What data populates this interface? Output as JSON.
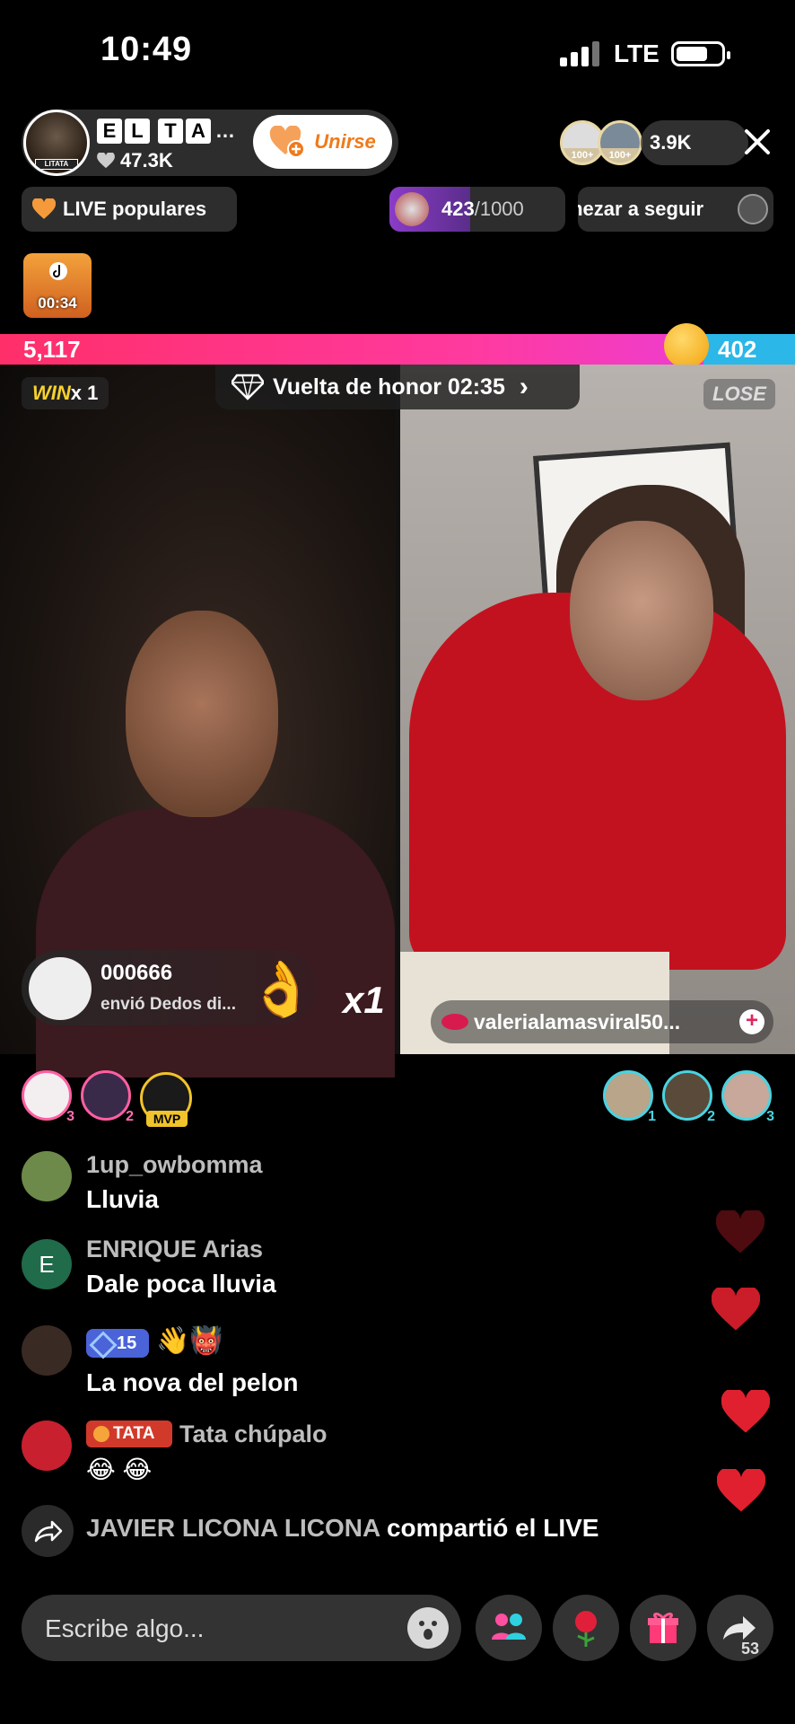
{
  "status_bar": {
    "time": "10:49",
    "network": "LTE"
  },
  "host": {
    "name_tiles": [
      "E",
      "L",
      "T",
      "A"
    ],
    "name_ellipsis": "…",
    "likes": "47.3K",
    "avatar_tag": "LITATA",
    "join_label": "Unirse"
  },
  "viewers": {
    "count": "3.9K",
    "badges": [
      "100+",
      "100+"
    ]
  },
  "top_row": {
    "live_popular": "LIVE populares",
    "goal_current": "423",
    "goal_total": "/1000",
    "follow_text": "mezar a seguir"
  },
  "treasure": {
    "timer": "00:34"
  },
  "battle": {
    "left_score": "5,117",
    "right_score": "402",
    "win_text": "WIN",
    "win_multiplier": "x 1",
    "lose_text": "LOSE",
    "honor_text": "Vuelta de honor 02:35",
    "honor_chevron": "›"
  },
  "gift_toast": {
    "user": "000666",
    "message": "envió Dedos di...",
    "multiplier": "x1"
  },
  "guest": {
    "username": "valerialamasviral50..."
  },
  "top_gifters_left": [
    {
      "rank": "3"
    },
    {
      "rank": "2"
    },
    {
      "label": "MVP"
    }
  ],
  "top_gifters_right": [
    {
      "rank": "1"
    },
    {
      "rank": "2"
    },
    {
      "rank": "3"
    }
  ],
  "chat": [
    {
      "name": "1up_owbomma",
      "message": "Lluvia"
    },
    {
      "name": "ENRIQUE Arias",
      "avatar_letter": "E",
      "message": "Dale poca lluvia"
    },
    {
      "badge": "15",
      "emojis": "👋👹",
      "message": "La nova del pelon"
    },
    {
      "badge": "TATA",
      "name": "Tata chúpalo",
      "message": "😂 😂"
    }
  ],
  "share_event": {
    "user": "JAVIER LICONA LICONA",
    "action": " compartió el LIVE"
  },
  "bottom": {
    "placeholder": "Escribe algo...",
    "share_count": "53"
  },
  "colors": {
    "accent_pink": "#ff2f6a",
    "accent_blue": "#2bb7e8",
    "heart_red": "#e0202e"
  }
}
